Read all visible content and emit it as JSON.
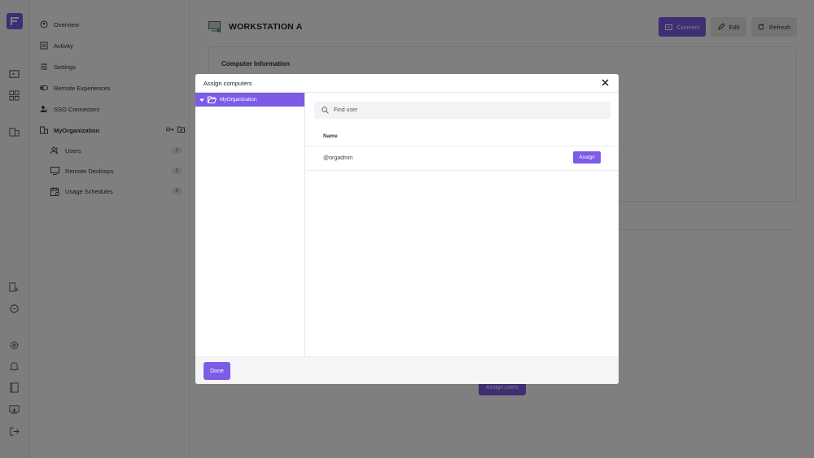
{
  "sidebar": {
    "items": [
      {
        "label": "Overview",
        "icon": "overview-icon"
      },
      {
        "label": "Activity",
        "icon": "activity-icon"
      },
      {
        "label": "Settings",
        "icon": "settings-sliders-icon"
      },
      {
        "label": "Remote Experiences",
        "icon": "toggle-icon"
      },
      {
        "label": "SSO Connectors",
        "icon": "user-key-icon"
      },
      {
        "label": "MyOrganization",
        "icon": "building-icon"
      }
    ],
    "sub_items": [
      {
        "label": "Users",
        "count": "1",
        "icon": "users-icon"
      },
      {
        "label": "Remote Desktops",
        "count": "1",
        "icon": "monitor-icon"
      },
      {
        "label": "Usage Schedules",
        "count": "0",
        "icon": "calendar-icon"
      }
    ]
  },
  "main": {
    "title": "WORKSTATION A",
    "connect_label": "Connect",
    "edit_label": "Edit",
    "refresh_label": "Refresh",
    "card_title": "Computer Information",
    "assign_users_label": "Assign users"
  },
  "modal": {
    "title": "Assign computers",
    "tree_item": "MyOrganization",
    "search_placeholder": "Find user",
    "search_value": "",
    "column_name": "Name",
    "rows": [
      {
        "name": "@orgadmin",
        "action": "Assign"
      }
    ],
    "done_label": "Done"
  },
  "colors": {
    "accent": "#7c5ce6",
    "overlay": "rgba(0,0,0,0.5)"
  }
}
